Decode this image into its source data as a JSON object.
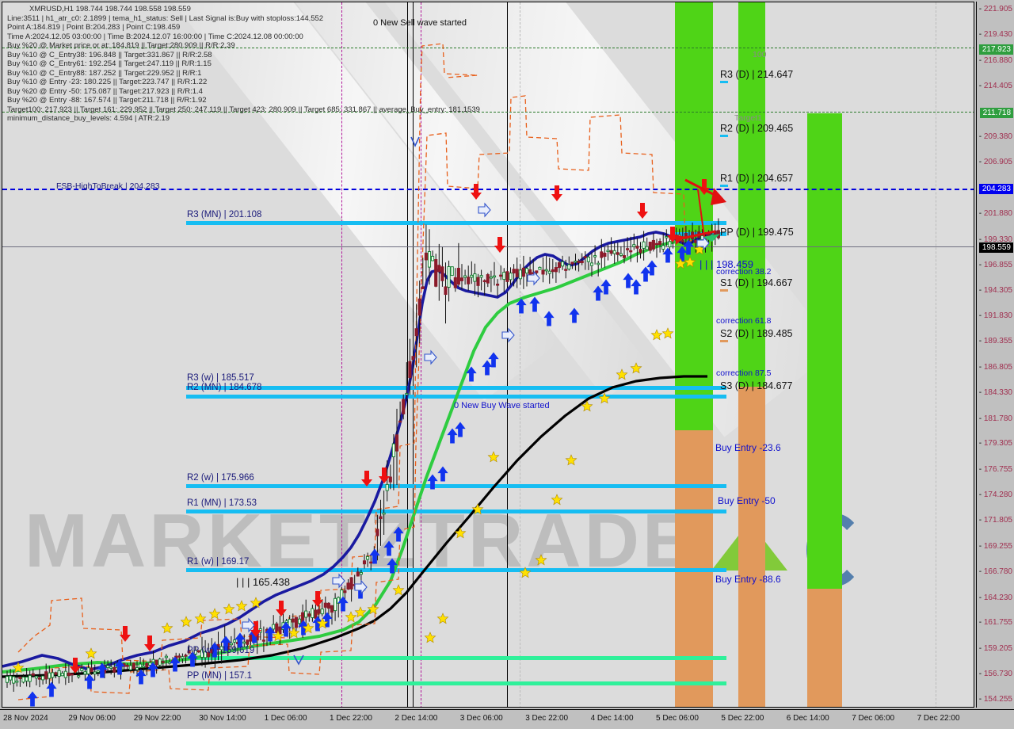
{
  "window": {
    "title": "XMRUSD,H1"
  },
  "header": {
    "symbol_line": "XMRUSD,H1  198.744 198.744 198.558 198.559",
    "lines": [
      "Line:3511 | h1_atr_c0: 2.1899 | tema_h1_status: Sell | Last Signal is:Buy with stoploss:144.552",
      "Point A:184.819 | Point B:204.283 | Point C:198.459",
      "Time A:2024.12.05 03:00:00 | Time B:2024.12.07 16:00:00 | Time C:2024.12.08 00:00:00",
      "Buy %20 @ Market price or at: 184.819 || Target:280.909 || R/R:2.39",
      "Buy %10 @ C_Entry38: 196.848 || Target:331.867 || R/R:2.58",
      "Buy %10 @ C_Entry61: 192.254 || Target:247.119 || R/R:1.15",
      "Buy %10 @ C_Entry88: 187.252 || Target:229.952 || R/R:1",
      "Buy %10 @ Entry -23: 180.225 || Target:223.747 || R/R:1.22",
      "Buy %20 @ Entry -50: 175.087 || Target:217.923 || R/R:1.4",
      "Buy %20 @ Entry -88: 167.574 || Target:211.718 || R/R:1.92",
      "Target100: 217.923 || Target 161: 229.952 || Target 250: 247.119 || Target 423: 280.909 || Target 685: 331.867 || average_Buy_entry: 181.1539",
      "minimum_distance_buy_levels: 4.594 | ATR:2.19"
    ]
  },
  "annotations": {
    "sell_wave": "0 New Sell wave started",
    "buy_wave": "0 New Buy Wave started",
    "point_c_label": "| | | 198.459",
    "low_label": "| | | 165.438"
  },
  "chart_data": {
    "type": "candlestick",
    "title": "XMRUSD,H1",
    "symbol": "XMRUSD",
    "timeframe": "H1",
    "ohlc": {
      "open": 198.744,
      "high": 198.744,
      "low": 198.558,
      "close": 198.559
    },
    "ylim": [
      154.255,
      221.905
    ],
    "xlabel": "",
    "ylabel": "",
    "grid": true,
    "price_ticks": [
      "221.905",
      "219.430",
      "217.923",
      "216.880",
      "214.405",
      "211.718",
      "209.380",
      "206.905",
      "204.283",
      "201.880",
      "199.330",
      "198.559",
      "196.855",
      "194.305",
      "191.830",
      "189.355",
      "186.805",
      "184.330",
      "181.780",
      "179.305",
      "176.755",
      "174.280",
      "171.805",
      "169.255",
      "166.780",
      "164.230",
      "161.755",
      "159.205",
      "156.730",
      "154.255"
    ],
    "highlighted_prices": [
      {
        "value": "217.923",
        "style": "green"
      },
      {
        "value": "211.718",
        "style": "green"
      },
      {
        "value": "204.283",
        "style": "blue"
      },
      {
        "value": "198.559",
        "style": "black"
      }
    ],
    "time_ticks": [
      "28 Nov 2024",
      "29 Nov 06:00",
      "29 Nov 22:00",
      "30 Nov 14:00",
      "1 Dec 06:00",
      "1 Dec 22:00",
      "2 Dec 14:00",
      "3 Dec 06:00",
      "3 Dec 22:00",
      "4 Dec 14:00",
      "5 Dec 06:00",
      "5 Dec 22:00",
      "6 Dec 14:00",
      "7 Dec 06:00",
      "7 Dec 22:00"
    ],
    "levels_left": [
      {
        "label": "FSB-HighToBreak | 204.283",
        "price": 204.283,
        "color": "#1a1a7a",
        "line": "dashed-blue"
      },
      {
        "label": "R3 (MN) | 201.108",
        "price": 201.108,
        "color": "#1a1a7a",
        "line": "cyan"
      },
      {
        "label": "R3 (w) | 185.517",
        "price": 185.517,
        "color": "#1a1a7a",
        "line": "cyan"
      },
      {
        "label": "R2 (MN) | 184.678",
        "price": 184.678,
        "color": "#1a1a7a",
        "line": "cyan"
      },
      {
        "label": "R2 (w) | 175.966",
        "price": 175.966,
        "color": "#1a1a7a",
        "line": "cyan"
      },
      {
        "label": "R1 (MN) | 173.53",
        "price": 173.53,
        "color": "#1a1a7a",
        "line": "cyan"
      },
      {
        "label": "R1 (w) | 169.17",
        "price": 169.17,
        "color": "#1a1a7a",
        "line": "cyan"
      },
      {
        "label": "PP (w) | 159.619",
        "price": 159.619,
        "color": "#1a1a7a",
        "line": "green"
      },
      {
        "label": "PP (MN) | 157.1",
        "price": 157.1,
        "color": "#1a1a7a",
        "line": "green"
      }
    ],
    "levels_right": [
      {
        "label": "100",
        "kind": "target",
        "color": "#8a8a8a"
      },
      {
        "label": "R3 (D) | 214.647",
        "price": 214.647,
        "kind": "pivot"
      },
      {
        "label": "Target1",
        "kind": "target",
        "color": "#8a8a8a"
      },
      {
        "label": "R2 (D) | 209.465",
        "price": 209.465,
        "kind": "pivot"
      },
      {
        "label": "R1 (D) | 204.657",
        "price": 204.657,
        "kind": "pivot"
      },
      {
        "label": "PP (D) | 199.475",
        "price": 199.475,
        "kind": "pivot"
      },
      {
        "label": "correction 38.2",
        "kind": "fib",
        "color": "#1111cc"
      },
      {
        "label": "S1 (D) | 194.667",
        "price": 194.667,
        "kind": "pivot"
      },
      {
        "label": "correction 61.8",
        "kind": "fib",
        "color": "#1111cc"
      },
      {
        "label": "S2 (D) | 189.485",
        "price": 189.485,
        "kind": "pivot"
      },
      {
        "label": "correction 87.5",
        "kind": "fib",
        "color": "#1111cc"
      },
      {
        "label": "S3 (D) | 184.677",
        "price": 184.677,
        "kind": "pivot"
      },
      {
        "label": "Buy Entry -23.6",
        "kind": "entry",
        "color": "#1111cc"
      },
      {
        "label": "Buy Entry -50",
        "kind": "entry",
        "color": "#1111cc"
      },
      {
        "label": "Buy Entry -88.6",
        "kind": "entry",
        "color": "#1111cc"
      }
    ],
    "colors": {
      "background": "#dcdcdc",
      "band_green": "#4fd417",
      "band_orange": "#e1995c",
      "level_cyan": "#16bdf2",
      "level_green": "#2ff09a",
      "ma_fast": "#1a1aa0",
      "ma_mid": "#2ecc40",
      "ma_slow": "#000000",
      "channel": "#e8601c",
      "arrow_up": "#1133ee",
      "arrow_down": "#ee1111",
      "star": "#ffe000"
    }
  },
  "watermark": {
    "text": "MARKETZTRADE"
  }
}
